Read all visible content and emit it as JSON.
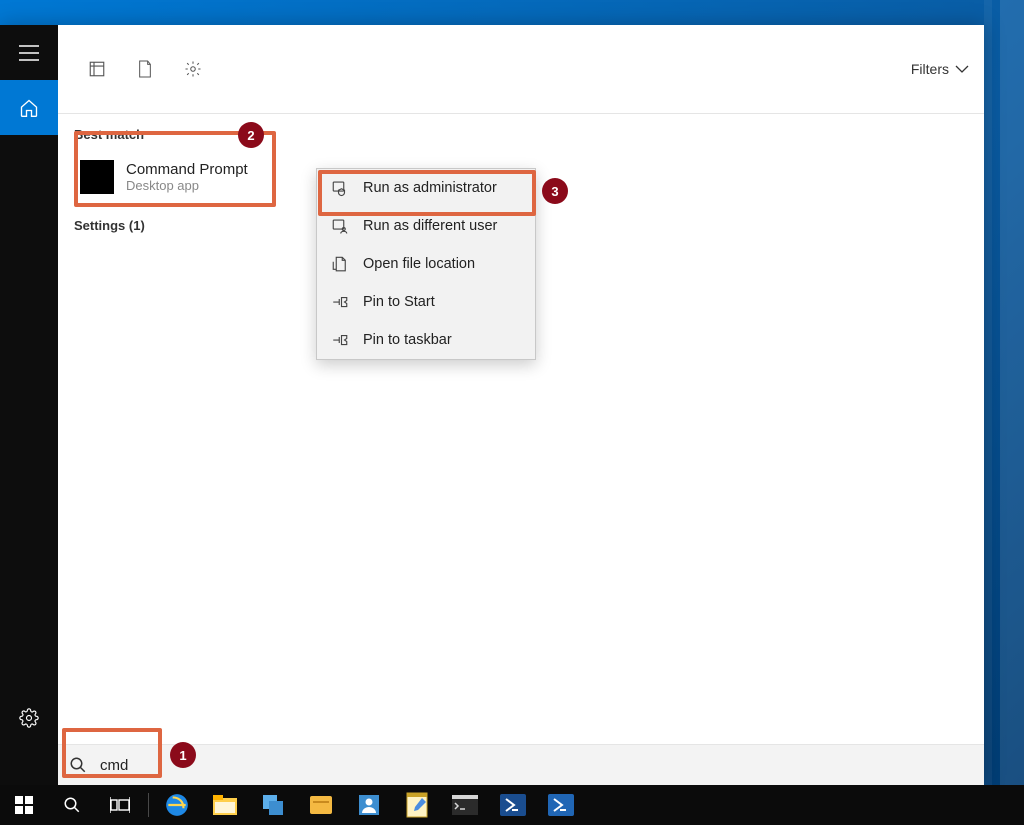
{
  "top_row": {
    "filters_label": "Filters"
  },
  "results": {
    "best_match_header": "Best match",
    "best_match_title": "Command Prompt",
    "best_match_subtitle": "Desktop app",
    "settings_label": "Settings (1)"
  },
  "context_menu": {
    "items": [
      {
        "label": "Run as administrator"
      },
      {
        "label": "Run as different user"
      },
      {
        "label": "Open file location"
      },
      {
        "label": "Pin to Start"
      },
      {
        "label": "Pin to taskbar"
      }
    ]
  },
  "search": {
    "query": "cmd"
  },
  "callouts": {
    "one": "1",
    "two": "2",
    "three": "3"
  }
}
